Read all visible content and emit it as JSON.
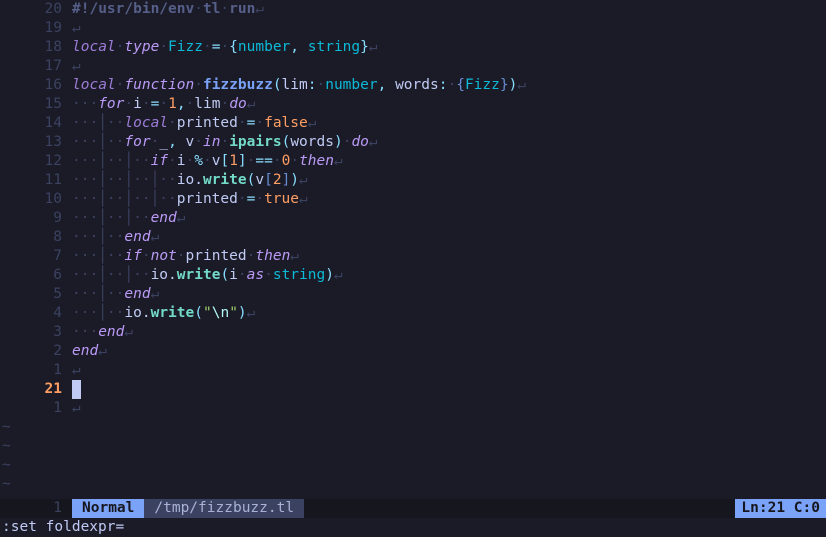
{
  "lines": [
    {
      "num": "20",
      "current": false,
      "segs": [
        {
          "t": "#!/usr/bin/env",
          "c": "shebang"
        },
        {
          "t": "·",
          "c": "ws"
        },
        {
          "t": "tl",
          "c": "shebang"
        },
        {
          "t": "·",
          "c": "ws"
        },
        {
          "t": "run",
          "c": "shebang"
        },
        {
          "t": "↵",
          "c": "eol"
        }
      ]
    },
    {
      "num": "19",
      "current": false,
      "segs": [
        {
          "t": "↵",
          "c": "eol"
        }
      ]
    },
    {
      "num": "18",
      "current": false,
      "segs": [
        {
          "t": "local",
          "c": "kw2"
        },
        {
          "t": "·",
          "c": "ws"
        },
        {
          "t": "type",
          "c": "kw"
        },
        {
          "t": "·",
          "c": "ws"
        },
        {
          "t": "Fizz",
          "c": "ty"
        },
        {
          "t": "·",
          "c": "ws"
        },
        {
          "t": "=",
          "c": "op"
        },
        {
          "t": "·",
          "c": "ws"
        },
        {
          "t": "{",
          "c": "brace1"
        },
        {
          "t": "number",
          "c": "ty"
        },
        {
          "t": ",",
          "c": "pun"
        },
        {
          "t": " ",
          "c": ""
        },
        {
          "t": "string",
          "c": "ty"
        },
        {
          "t": "}",
          "c": "brace1"
        },
        {
          "t": "↵",
          "c": "eol"
        }
      ]
    },
    {
      "num": "17",
      "current": false,
      "segs": [
        {
          "t": "↵",
          "c": "eol"
        }
      ]
    },
    {
      "num": "16",
      "current": false,
      "segs": [
        {
          "t": "local",
          "c": "kw2"
        },
        {
          "t": "·",
          "c": "ws"
        },
        {
          "t": "function",
          "c": "kw"
        },
        {
          "t": "·",
          "c": "ws"
        },
        {
          "t": "fizzbuzz",
          "c": "fn"
        },
        {
          "t": "(",
          "c": "brace1"
        },
        {
          "t": "lim",
          "c": "id"
        },
        {
          "t": ":",
          "c": "pun"
        },
        {
          "t": "·",
          "c": "ws"
        },
        {
          "t": "number",
          "c": "ty"
        },
        {
          "t": ",",
          "c": "pun"
        },
        {
          "t": " ",
          "c": ""
        },
        {
          "t": "words",
          "c": "id"
        },
        {
          "t": ":",
          "c": "pun"
        },
        {
          "t": "·",
          "c": "ws"
        },
        {
          "t": "{",
          "c": "brace2"
        },
        {
          "t": "Fizz",
          "c": "ty"
        },
        {
          "t": "}",
          "c": "brace2"
        },
        {
          "t": ")",
          "c": "brace1"
        },
        {
          "t": "↵",
          "c": "eol"
        }
      ]
    },
    {
      "num": "15",
      "current": false,
      "segs": [
        {
          "t": "···",
          "c": "ws"
        },
        {
          "t": "for",
          "c": "kw"
        },
        {
          "t": "·",
          "c": "ws"
        },
        {
          "t": "i",
          "c": "id"
        },
        {
          "t": "·",
          "c": "ws"
        },
        {
          "t": "=",
          "c": "op"
        },
        {
          "t": "·",
          "c": "ws"
        },
        {
          "t": "1",
          "c": "num"
        },
        {
          "t": ",",
          "c": "pun"
        },
        {
          "t": "·",
          "c": "ws"
        },
        {
          "t": "lim",
          "c": "id"
        },
        {
          "t": "·",
          "c": "ws"
        },
        {
          "t": "do",
          "c": "kw"
        },
        {
          "t": "↵",
          "c": "eol"
        }
      ]
    },
    {
      "num": "14",
      "current": false,
      "segs": [
        {
          "t": "···│··",
          "c": "ws"
        },
        {
          "t": "local",
          "c": "kw2"
        },
        {
          "t": "·",
          "c": "ws"
        },
        {
          "t": "printed",
          "c": "id"
        },
        {
          "t": "·",
          "c": "ws"
        },
        {
          "t": "=",
          "c": "op"
        },
        {
          "t": "·",
          "c": "ws"
        },
        {
          "t": "false",
          "c": "bool"
        },
        {
          "t": "↵",
          "c": "eol"
        }
      ]
    },
    {
      "num": "13",
      "current": false,
      "segs": [
        {
          "t": "···│··",
          "c": "ws"
        },
        {
          "t": "for",
          "c": "kw"
        },
        {
          "t": "·",
          "c": "ws"
        },
        {
          "t": "_",
          "c": "id"
        },
        {
          "t": ",",
          "c": "pun"
        },
        {
          "t": " ",
          "c": ""
        },
        {
          "t": "v",
          "c": "id"
        },
        {
          "t": "·",
          "c": "ws"
        },
        {
          "t": "in",
          "c": "kw"
        },
        {
          "t": "·",
          "c": "ws"
        },
        {
          "t": "ipairs",
          "c": "fnname"
        },
        {
          "t": "(",
          "c": "brace1"
        },
        {
          "t": "words",
          "c": "id"
        },
        {
          "t": ")",
          "c": "brace1"
        },
        {
          "t": "·",
          "c": "ws"
        },
        {
          "t": "do",
          "c": "kw"
        },
        {
          "t": "↵",
          "c": "eol"
        }
      ]
    },
    {
      "num": "12",
      "current": false,
      "segs": [
        {
          "t": "···│··│··",
          "c": "ws"
        },
        {
          "t": "if",
          "c": "kw"
        },
        {
          "t": "·",
          "c": "ws"
        },
        {
          "t": "i",
          "c": "id"
        },
        {
          "t": "·",
          "c": "ws"
        },
        {
          "t": "%",
          "c": "op"
        },
        {
          "t": "·",
          "c": "ws"
        },
        {
          "t": "v",
          "c": "id"
        },
        {
          "t": "[",
          "c": "brace1"
        },
        {
          "t": "1",
          "c": "num"
        },
        {
          "t": "]",
          "c": "brace1"
        },
        {
          "t": "·",
          "c": "ws"
        },
        {
          "t": "==",
          "c": "op"
        },
        {
          "t": "·",
          "c": "ws"
        },
        {
          "t": "0",
          "c": "num"
        },
        {
          "t": "·",
          "c": "ws"
        },
        {
          "t": "then",
          "c": "kw"
        },
        {
          "t": "↵",
          "c": "eol"
        }
      ]
    },
    {
      "num": "11",
      "current": false,
      "segs": [
        {
          "t": "···│··│··│··",
          "c": "ws"
        },
        {
          "t": "io",
          "c": "obj"
        },
        {
          "t": ".",
          "c": "punc"
        },
        {
          "t": "write",
          "c": "fnname"
        },
        {
          "t": "(",
          "c": "brace1"
        },
        {
          "t": "v",
          "c": "id"
        },
        {
          "t": "[",
          "c": "brace2"
        },
        {
          "t": "2",
          "c": "num"
        },
        {
          "t": "]",
          "c": "brace2"
        },
        {
          "t": ")",
          "c": "brace1"
        },
        {
          "t": "↵",
          "c": "eol"
        }
      ]
    },
    {
      "num": "10",
      "current": false,
      "segs": [
        {
          "t": "···│··│··│··",
          "c": "ws"
        },
        {
          "t": "printed",
          "c": "id"
        },
        {
          "t": "·",
          "c": "ws"
        },
        {
          "t": "=",
          "c": "op"
        },
        {
          "t": "·",
          "c": "ws"
        },
        {
          "t": "true",
          "c": "bool"
        },
        {
          "t": "↵",
          "c": "eol"
        }
      ]
    },
    {
      "num": "9",
      "current": false,
      "segs": [
        {
          "t": "···│··│··",
          "c": "ws"
        },
        {
          "t": "end",
          "c": "kw"
        },
        {
          "t": "↵",
          "c": "eol"
        }
      ]
    },
    {
      "num": "8",
      "current": false,
      "segs": [
        {
          "t": "···│··",
          "c": "ws"
        },
        {
          "t": "end",
          "c": "kw"
        },
        {
          "t": "↵",
          "c": "eol"
        }
      ]
    },
    {
      "num": "7",
      "current": false,
      "segs": [
        {
          "t": "···│··",
          "c": "ws"
        },
        {
          "t": "if",
          "c": "kw"
        },
        {
          "t": "·",
          "c": "ws"
        },
        {
          "t": "not",
          "c": "kw"
        },
        {
          "t": "·",
          "c": "ws"
        },
        {
          "t": "printed",
          "c": "id"
        },
        {
          "t": "·",
          "c": "ws"
        },
        {
          "t": "then",
          "c": "kw"
        },
        {
          "t": "↵",
          "c": "eol"
        }
      ]
    },
    {
      "num": "6",
      "current": false,
      "segs": [
        {
          "t": "···│··│··",
          "c": "ws"
        },
        {
          "t": "io",
          "c": "obj"
        },
        {
          "t": ".",
          "c": "punc"
        },
        {
          "t": "write",
          "c": "fnname"
        },
        {
          "t": "(",
          "c": "brace1"
        },
        {
          "t": "i",
          "c": "id"
        },
        {
          "t": "·",
          "c": "ws"
        },
        {
          "t": "as",
          "c": "kw"
        },
        {
          "t": "·",
          "c": "ws"
        },
        {
          "t": "string",
          "c": "ty"
        },
        {
          "t": ")",
          "c": "brace1"
        },
        {
          "t": "↵",
          "c": "eol"
        }
      ]
    },
    {
      "num": "5",
      "current": false,
      "segs": [
        {
          "t": "···│··",
          "c": "ws"
        },
        {
          "t": "end",
          "c": "kw"
        },
        {
          "t": "↵",
          "c": "eol"
        }
      ]
    },
    {
      "num": "4",
      "current": false,
      "segs": [
        {
          "t": "···│··",
          "c": "ws"
        },
        {
          "t": "io",
          "c": "obj"
        },
        {
          "t": ".",
          "c": "punc"
        },
        {
          "t": "write",
          "c": "fnname"
        },
        {
          "t": "(",
          "c": "brace1"
        },
        {
          "t": "\"",
          "c": "strq"
        },
        {
          "t": "\\n",
          "c": "strE"
        },
        {
          "t": "\"",
          "c": "strq"
        },
        {
          "t": ")",
          "c": "brace1"
        },
        {
          "t": "↵",
          "c": "eol"
        }
      ]
    },
    {
      "num": "3",
      "current": false,
      "segs": [
        {
          "t": "···",
          "c": "ws"
        },
        {
          "t": "end",
          "c": "kw"
        },
        {
          "t": "↵",
          "c": "eol"
        }
      ]
    },
    {
      "num": "2",
      "current": false,
      "segs": [
        {
          "t": "end",
          "c": "kw"
        },
        {
          "t": "↵",
          "c": "eol"
        }
      ]
    },
    {
      "num": "1",
      "current": false,
      "segs": [
        {
          "t": "↵",
          "c": "eol"
        }
      ]
    },
    {
      "num": "21",
      "current": true,
      "cursor": true,
      "segs": [
        {
          "t": " ",
          "c": "cursor-block"
        }
      ]
    },
    {
      "num": "1",
      "current": false,
      "segs": [
        {
          "t": "↵",
          "c": "eol"
        }
      ]
    }
  ],
  "tildes": [
    "~",
    "~",
    "~",
    "~"
  ],
  "status": {
    "num": "1",
    "mode": "Normal",
    "file": "/tmp/fizzbuzz.tl",
    "pos": "Ln:21 C:0"
  },
  "cmdline": ":set foldexpr="
}
